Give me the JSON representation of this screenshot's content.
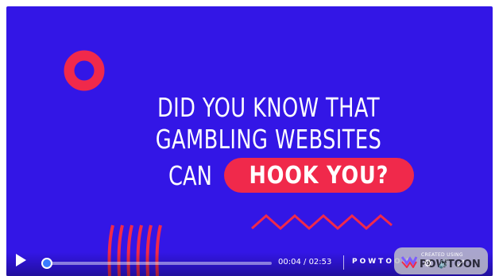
{
  "headline": {
    "line1": "DID YOU KNOW THAT",
    "line2": "GAMBLING WEBSITES",
    "line3_prefix": "CAN",
    "line3_highlight": "HOOK YOU?"
  },
  "colors": {
    "background": "#3316e6",
    "accent_red": "#f0294b",
    "text": "#ffffff",
    "progress_knob": "#3a7bff"
  },
  "player": {
    "current_time": "00:04",
    "duration": "02:53",
    "time_separator": " / ",
    "progress_fraction": 0.023,
    "brand_label": "POWTOON",
    "badge_small": "CREATED USING",
    "badge_big": "POWTOON"
  },
  "icons": [
    "play-icon",
    "settings-icon",
    "volume-icon",
    "fullscreen-icon",
    "powtoon-logo-icon"
  ]
}
